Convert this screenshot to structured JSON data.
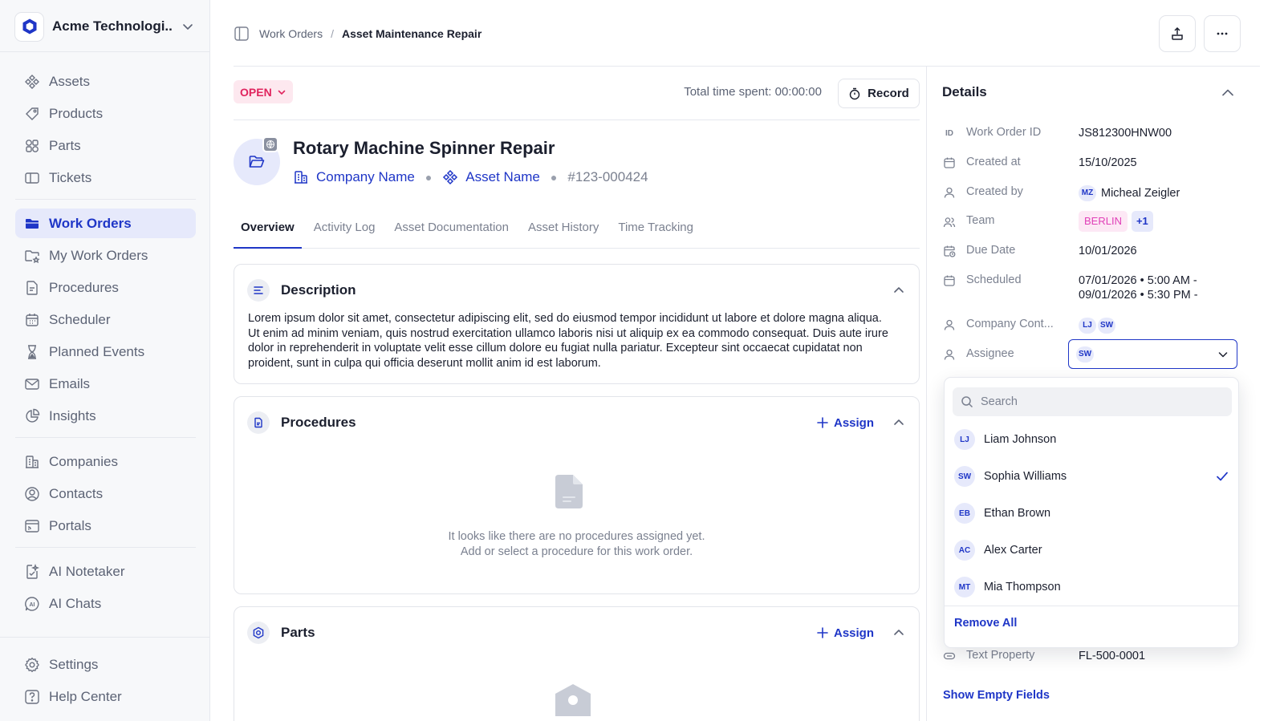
{
  "org": {
    "name": "Acme Technologi..."
  },
  "sidebar": {
    "groups": [
      [
        {
          "label": "Assets",
          "icon": "assets-icon"
        },
        {
          "label": "Products",
          "icon": "tag-icon"
        },
        {
          "label": "Parts",
          "icon": "parts-icon"
        },
        {
          "label": "Tickets",
          "icon": "ticket-icon"
        }
      ],
      [
        {
          "label": "Work Orders",
          "icon": "folder-icon",
          "active": true
        },
        {
          "label": "My Work Orders",
          "icon": "my-work-orders-icon"
        },
        {
          "label": "Procedures",
          "icon": "document-icon"
        },
        {
          "label": "Scheduler",
          "icon": "calendar-icon"
        },
        {
          "label": "Planned Events",
          "icon": "hourglass-icon"
        },
        {
          "label": "Emails",
          "icon": "mail-icon"
        },
        {
          "label": "Insights",
          "icon": "pie-chart-icon"
        }
      ],
      [
        {
          "label": "Companies",
          "icon": "building-icon"
        },
        {
          "label": "Contacts",
          "icon": "contact-icon"
        },
        {
          "label": "Portals",
          "icon": "portal-icon"
        }
      ],
      [
        {
          "label": "AI Notetaker",
          "icon": "ai-notetaker-icon"
        },
        {
          "label": "AI Chats",
          "icon": "ai-chat-icon"
        }
      ]
    ],
    "bottom": [
      {
        "label": "Settings",
        "icon": "gear-icon"
      },
      {
        "label": "Help Center",
        "icon": "help-icon"
      }
    ]
  },
  "breadcrumb": {
    "parent": "Work Orders",
    "separator": "/",
    "current": "Asset Maintenance Repair"
  },
  "status": {
    "label": "OPEN",
    "color": "#e0245e"
  },
  "time": {
    "text": "Total time spent: 00:00:00",
    "record_label": "Record"
  },
  "work_order": {
    "title": "Rotary Machine Spinner Repair",
    "company": "Company Name",
    "asset": "Asset Name",
    "number": "#123-000424"
  },
  "tabs": [
    "Overview",
    "Activity Log",
    "Asset Documentation",
    "Asset History",
    "Time Tracking"
  ],
  "description": {
    "title": "Description",
    "text": "Lorem ipsum dolor sit amet, consectetur adipiscing elit, sed do eiusmod tempor incididunt ut labore et dolore magna aliqua. Ut enim ad minim veniam, quis nostrud exercitation ullamco laboris nisi ut aliquip ex ea commodo consequat. Duis aute irure dolor in reprehenderit in voluptate velit esse cillum dolore eu fugiat nulla pariatur. Excepteur sint occaecat cupidatat non proident, sunt in culpa qui officia deserunt mollit anim id est laborum."
  },
  "procedures": {
    "title": "Procedures",
    "assign_label": "Assign",
    "empty_line1": "It looks like there are no procedures assigned yet.",
    "empty_line2": "Add or select a procedure for this work order."
  },
  "parts": {
    "title": "Parts",
    "assign_label": "Assign"
  },
  "details": {
    "title": "Details",
    "work_order_id": {
      "label": "Work Order ID",
      "value": "JS812300HNW00",
      "icon_text": "ID"
    },
    "created_at": {
      "label": "Created at",
      "value": "15/10/2025"
    },
    "created_by": {
      "label": "Created by",
      "initials": "MZ",
      "value": "Micheal Zeigler"
    },
    "team": {
      "label": "Team",
      "value": "BERLIN",
      "extra": "+1"
    },
    "due_date": {
      "label": "Due Date",
      "value": "10/01/2026"
    },
    "scheduled": {
      "label": "Scheduled",
      "line1": "07/01/2026 • 5:00 AM -",
      "line2": "09/01/2026 • 5:30 PM -"
    },
    "company_contact": {
      "label": "Company Cont...",
      "initials": [
        "LJ",
        "SW"
      ]
    },
    "assignee": {
      "label": "Assignee",
      "initials": "SW"
    },
    "text_property": {
      "label": "Text Property",
      "value": "FL-500-0001"
    },
    "show_empty_label": "Show Empty Fields"
  },
  "assignee_dropdown": {
    "search_placeholder": "Search",
    "options": [
      {
        "initials": "LJ",
        "name": "Liam Johnson",
        "selected": false
      },
      {
        "initials": "SW",
        "name": "Sophia Williams",
        "selected": true
      },
      {
        "initials": "EB",
        "name": "Ethan Brown",
        "selected": false
      },
      {
        "initials": "AC",
        "name": "Alex Carter",
        "selected": false
      },
      {
        "initials": "MT",
        "name": "Mia Thompson",
        "selected": false
      }
    ],
    "remove_all_label": "Remove All"
  },
  "colors": {
    "accent": "#1f36c7",
    "accent_bg": "#e6e9fb",
    "status_open": "#e0245e",
    "team_badge": "#e040b8"
  }
}
